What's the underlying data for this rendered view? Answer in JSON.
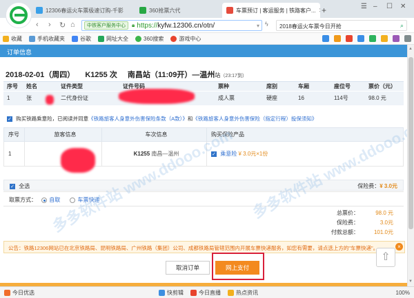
{
  "browser": {
    "tabs": [
      {
        "title": "12306春运火车票极速订购-千影",
        "color": "#3aa0e8"
      },
      {
        "title": "360抢票六代",
        "color": "#27a844"
      },
      {
        "title": "车票预订 | 客运服务 | 铁路客户...",
        "color": "#e54b3c"
      }
    ],
    "new_tab": "+",
    "url_badge": "中铁客户服务中心",
    "url_scheme": "https://",
    "url_rest": "kyfw.12306.cn/otn/",
    "search_text": "2018春运火车票今日开抢",
    "favorites": [
      {
        "label": "收藏",
        "color": "#f2b01e"
      },
      {
        "label": "手机收藏夹",
        "color": "#5b9bd5"
      },
      {
        "label": "谷歌",
        "color": "#4285f4"
      },
      {
        "label": "网址大全",
        "color": "#25a85a"
      },
      {
        "label": "360搜索",
        "color": "#3cb54a"
      },
      {
        "label": "游戏中心",
        "color": "#e8442e"
      }
    ]
  },
  "order": {
    "section_title": "订单信息",
    "trip": {
      "date": "2018-02-01（周四）",
      "train": "K1255 次",
      "from": "南昌",
      "from_suffix": "站（11:09开）",
      "to": "—温州",
      "to_suffix": "站",
      "duration": "（23:17到）"
    },
    "passenger_headers": [
      "序号",
      "姓名",
      "证件类型",
      "证件号码",
      "票种",
      "席别",
      "车厢",
      "座位号",
      "票价（元）"
    ],
    "passenger_row": [
      "1",
      "张",
      "二代身份证",
      "",
      "成人票",
      "硬座",
      "16",
      "114号",
      "98.0 元"
    ]
  },
  "insurance": {
    "agree_prefix": "购买铁路乘意险，已阅读并同意",
    "link1": "《铁路旅客人身意外伤害保险条款（A款）》",
    "and": "和",
    "link2": "《铁路旅客人身意外伤害保险（指定行程）投保须知》",
    "headers": [
      "序号",
      "旅客信息",
      "车次信息",
      "购买保险产品"
    ],
    "row": {
      "index": "1",
      "train": "K1255",
      "route": "南昌—温州",
      "product": "乘意险",
      "price": "¥ 3.0元×1份"
    },
    "select_all": "全选",
    "fee_label": "保险费：",
    "fee_value": "¥ 3.0元"
  },
  "collection": {
    "label": "取票方式：",
    "opt_self": "自取",
    "opt_express": "车票快递"
  },
  "totals": {
    "rows": [
      {
        "label": "总票价：",
        "value": "98.0 元"
      },
      {
        "label": "保险费：",
        "value": "3.0元"
      },
      {
        "label": "付款总额：",
        "value": "101.0元"
      }
    ]
  },
  "notice": "公告：铁路12306网站已在北京铁路局、昆明铁路局、广州铁路（集团）公司、成都铁路局管辖范围内开展车票快递服务，如您有需要，请点选上方的\"车票快递\"。",
  "buttons": {
    "cancel": "取消订单",
    "pay": "网上支付"
  },
  "watermark": "多多软件站 www.ddooo.com",
  "statusbar": {
    "items": [
      {
        "label": "今日优选",
        "color": "#f06d2b"
      },
      {
        "label": "快剪辑",
        "color": "#3d8fe0"
      },
      {
        "label": "今日直播",
        "color": "#e8442e"
      },
      {
        "label": "热点资讯",
        "color": "#f2b01e"
      }
    ],
    "zoom": "100%"
  }
}
